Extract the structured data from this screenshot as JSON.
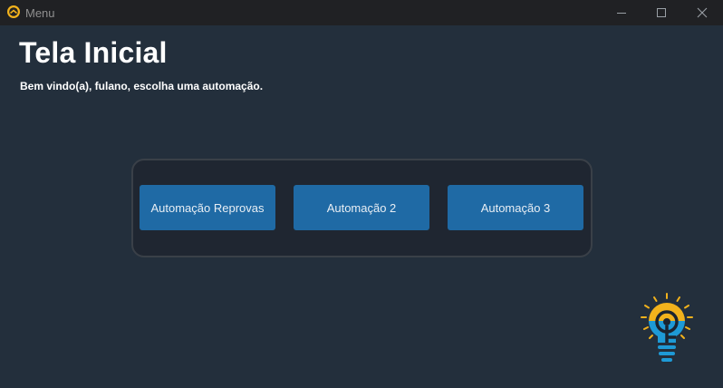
{
  "window": {
    "title": "Menu",
    "app_icon": "gauge-icon",
    "controls": [
      "minimize-icon",
      "maximize-icon",
      "close-icon"
    ]
  },
  "page": {
    "title": "Tela Inicial",
    "subtitle": "Bem vindo(a), fulano, escolha uma automação."
  },
  "automations": [
    {
      "label": "Automação Reprovas"
    },
    {
      "label": "Automação 2"
    },
    {
      "label": "Automação 3"
    }
  ],
  "logo": {
    "icon": "lightbulb-logo-icon"
  },
  "colors": {
    "background": "#232f3c",
    "titlebar": "#202124",
    "panel": "#1f2631",
    "panel_border": "#3a4048",
    "button": "#1f6aa5",
    "logo_yellow": "#f2b21c",
    "logo_blue": "#1e9ad6"
  }
}
